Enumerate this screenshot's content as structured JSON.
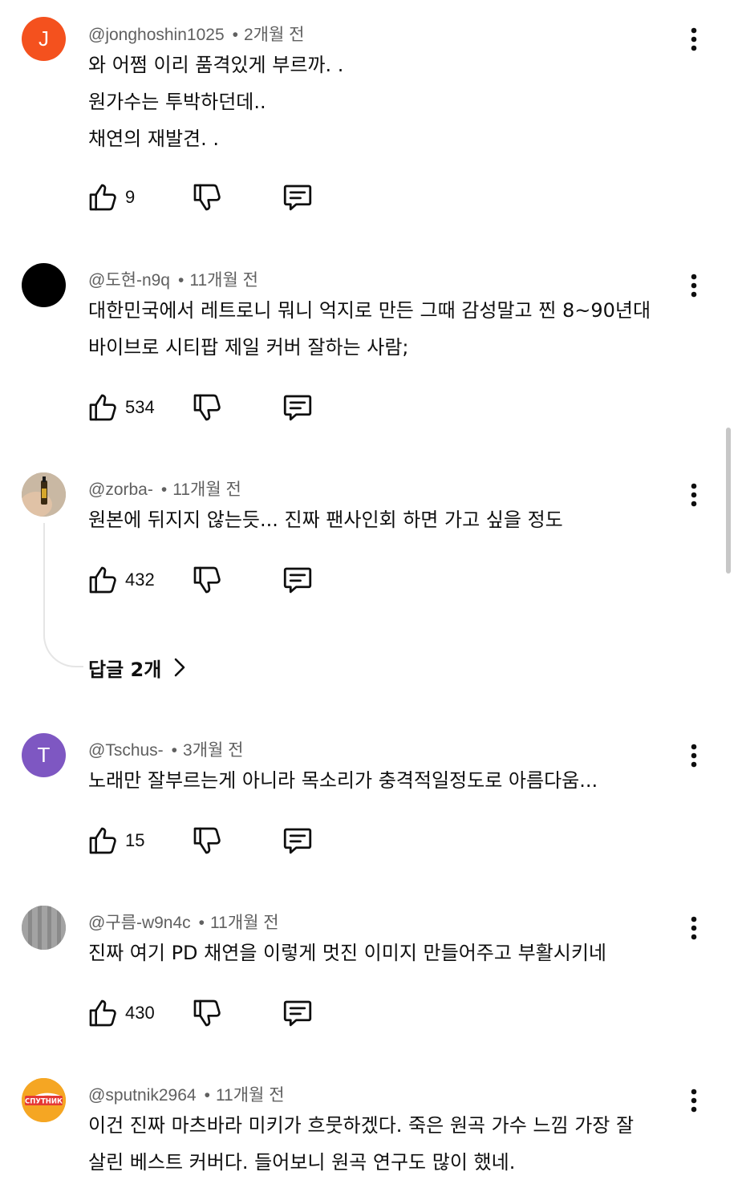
{
  "colors": {
    "avatar_j": "#f4511e",
    "avatar_black": "#000000",
    "avatar_t": "#7e57c2",
    "avatar_gray": "#9e9e9e",
    "avatar_sputnik": "#f5a623"
  },
  "comments": [
    {
      "author": "@jonghoshin1025",
      "time": "2개월 전",
      "avatar_letter": "J",
      "text": "와  어쩜  이리  품격있게  부르까. .\n원가수는 투박하던데..\n채연의  재발견. .",
      "likes": "9"
    },
    {
      "author": "@도현-n9q",
      "time": "11개월 전",
      "avatar_letter": "",
      "text": "대한민국에서 레트로니 뭐니 억지로 만든 그때 감성말고 찐 8~90년대\n바이브로 시티팝 제일 커버 잘하는 사람;",
      "likes": "534"
    },
    {
      "author": "@zorba-",
      "time": "11개월 전",
      "avatar_letter": "",
      "text": "원본에 뒤지지 않는듯... 진짜 팬사인회 하면 가고 싶을 정도",
      "likes": "432",
      "replies_label": "답글 2개"
    },
    {
      "author": "@Tschus-",
      "time": "3개월 전",
      "avatar_letter": "T",
      "text": "노래만 잘부르는게 아니라 목소리가 충격적일정도로 아름다움...",
      "likes": "15"
    },
    {
      "author": "@구름-w9n4c",
      "time": "11개월 전",
      "avatar_letter": "",
      "text": "진짜 여기 PD 채연을 이렇게 멋진 이미지 만들어주고 부활시키네",
      "likes": "430"
    },
    {
      "author": "@sputnik2964",
      "time": "11개월 전",
      "avatar_letter": "СПУТНИК",
      "text": "이건 진짜 마츠바라 미키가 흐뭇하겠다. 죽은 원곡 가수 느낌 가장 잘\n살린 베스트 커버다. 들어보니 원곡 연구도 많이 했네.",
      "likes": ""
    }
  ],
  "separator": "•",
  "icons": {
    "like": "thumbs-up-icon",
    "dislike": "thumbs-down-icon",
    "reply": "comment-icon",
    "more": "more-vertical-icon",
    "chevron": "chevron-right-icon"
  }
}
